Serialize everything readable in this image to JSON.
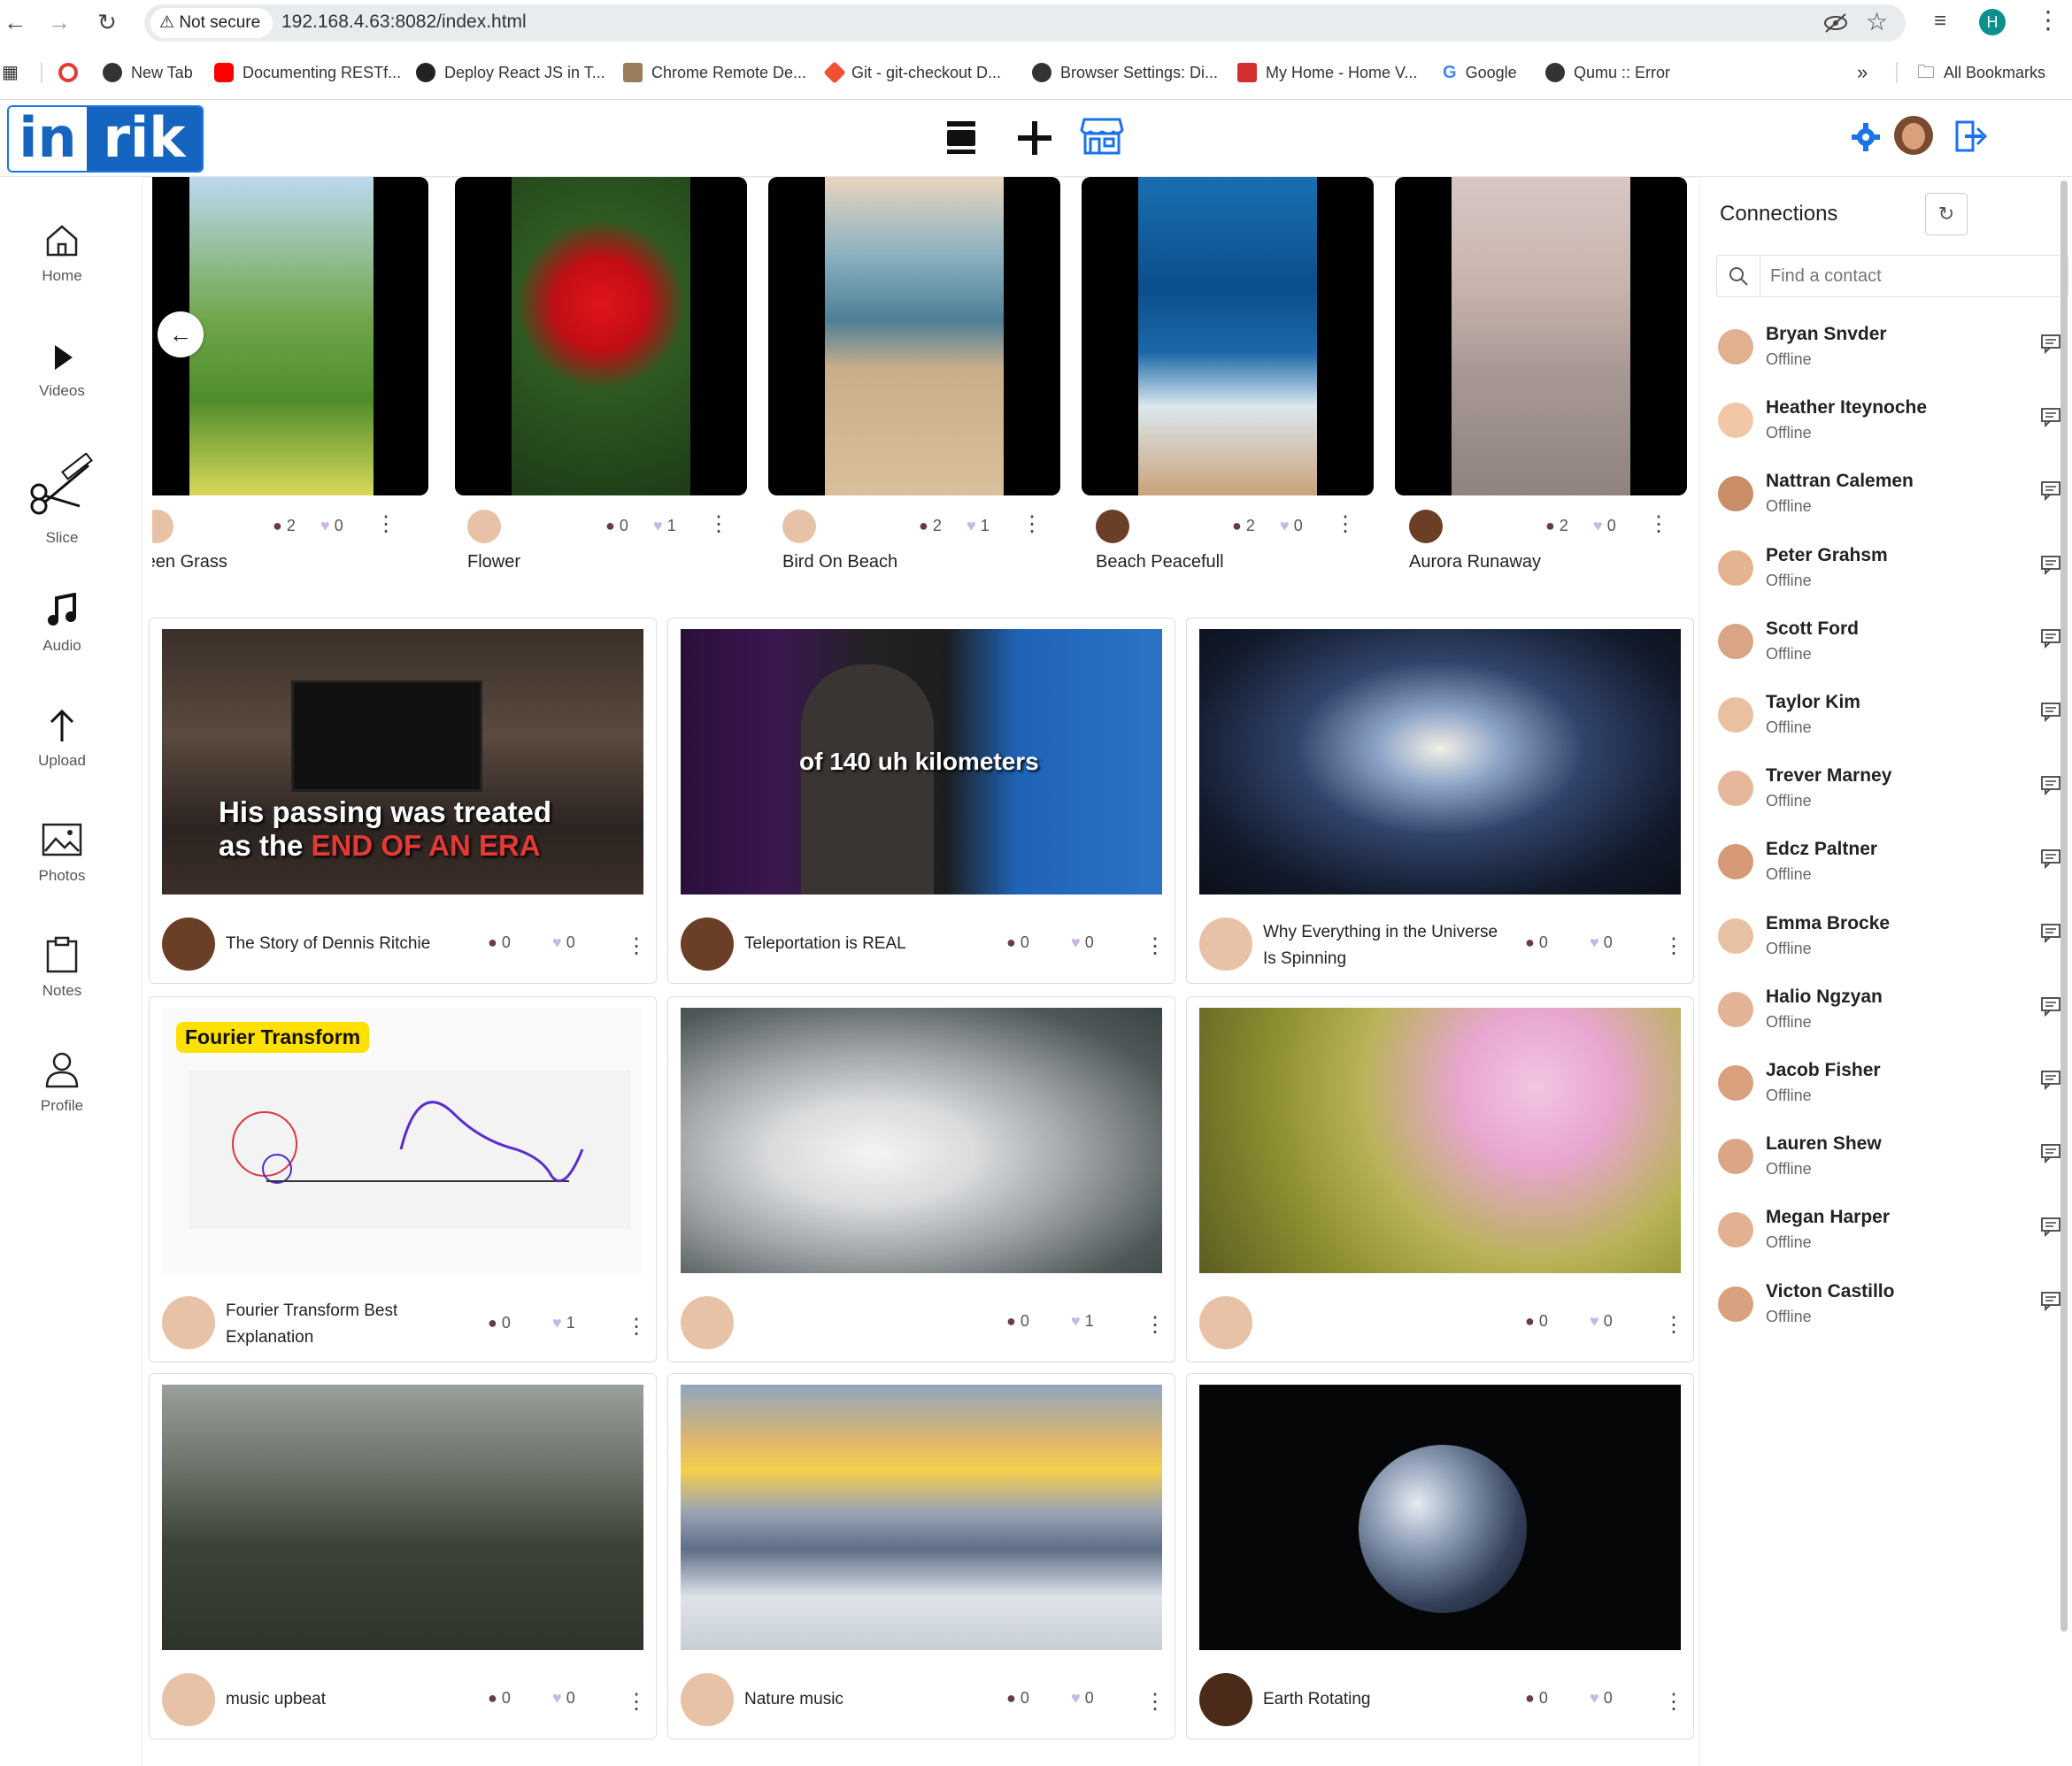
{
  "browser": {
    "not_secure": "Not secure",
    "url": "192.168.4.63:8082/index.html",
    "profile_initial": "H",
    "bookmarks": [
      "New Tab",
      "Documenting RESTf...",
      "Deploy React JS in T...",
      "Chrome Remote De...",
      "Git - git-checkout D...",
      "Browser Settings: Di...",
      "My Home - Home V...",
      "Google",
      "Qumu :: Error"
    ],
    "all_bookmarks": "All Bookmarks",
    "more": "»"
  },
  "logo": {
    "part1": "in",
    "part2": "rik"
  },
  "sidebar": {
    "items": [
      {
        "label": "Home"
      },
      {
        "label": "Videos"
      },
      {
        "label": "Slice"
      },
      {
        "label": "Audio"
      },
      {
        "label": "Upload"
      },
      {
        "label": "Photos"
      },
      {
        "label": "Notes"
      },
      {
        "label": "Profile"
      }
    ]
  },
  "reels": [
    {
      "title": "Green Grass",
      "title_visible": "reen Grass",
      "views": "2",
      "likes": "0"
    },
    {
      "title": "Flower",
      "views": "0",
      "likes": "1"
    },
    {
      "title": "Bird On Beach",
      "views": "2",
      "likes": "1"
    },
    {
      "title": "Beach Peacefull",
      "views": "2",
      "likes": "0"
    },
    {
      "title": "Aurora Runaway",
      "views": "2",
      "likes": "0"
    }
  ],
  "carousel": {
    "back_arrow": "←"
  },
  "videos": [
    {
      "title": "The Story of Dennis Ritchie",
      "views": "0",
      "likes": "0",
      "caption_line1": "His passing was treated",
      "caption_line2a": "as the ",
      "caption_line2b": "END OF AN ERA"
    },
    {
      "title": "Teleportation is REAL",
      "views": "0",
      "likes": "0",
      "caption": "of 140 uh kilometers"
    },
    {
      "title_line1": "Why Everything in the Universe",
      "title_line2": "Is Spinning",
      "views": "0",
      "likes": "0"
    },
    {
      "title_line1": "Fourier Transform Best",
      "title_line2": "Explanation",
      "views": "0",
      "likes": "1",
      "badge": "Fourier Transform"
    },
    {
      "title": "",
      "views": "0",
      "likes": "1"
    },
    {
      "title": "",
      "views": "0",
      "likes": "0"
    },
    {
      "title": "music upbeat",
      "views": "0",
      "likes": "0"
    },
    {
      "title": "Nature music",
      "views": "0",
      "likes": "0"
    },
    {
      "title": "Earth Rotating",
      "views": "0",
      "likes": "0"
    }
  ],
  "connections": {
    "title": "Connections",
    "search_placeholder": "Find a contact",
    "contacts": [
      {
        "name": "Bryan Snvder",
        "status": "Offline"
      },
      {
        "name": "Heather Iteynoche",
        "status": "Offline"
      },
      {
        "name": "Nattran Calemen",
        "status": "Offline"
      },
      {
        "name": "Peter Grahsm",
        "status": "Offline"
      },
      {
        "name": "Scott Ford",
        "status": "Offline"
      },
      {
        "name": "Taylor Kim",
        "status": "Offline"
      },
      {
        "name": "Trever Marney",
        "status": "Offline"
      },
      {
        "name": "Edcz Paltner",
        "status": "Offline"
      },
      {
        "name": "Emma Brocke",
        "status": "Offline"
      },
      {
        "name": "Halio Ngzyan",
        "status": "Offline"
      },
      {
        "name": "Jacob Fisher",
        "status": "Offline"
      },
      {
        "name": "Lauren Shew",
        "status": "Offline"
      },
      {
        "name": "Megan Harper",
        "status": "Offline"
      },
      {
        "name": "Victon Castillo",
        "status": "Offline"
      }
    ]
  },
  "colors": {
    "accent": "#1a73e8",
    "brand": "#1565c0",
    "caption_red": "#e53935",
    "badge_yellow": "#ffe100"
  }
}
